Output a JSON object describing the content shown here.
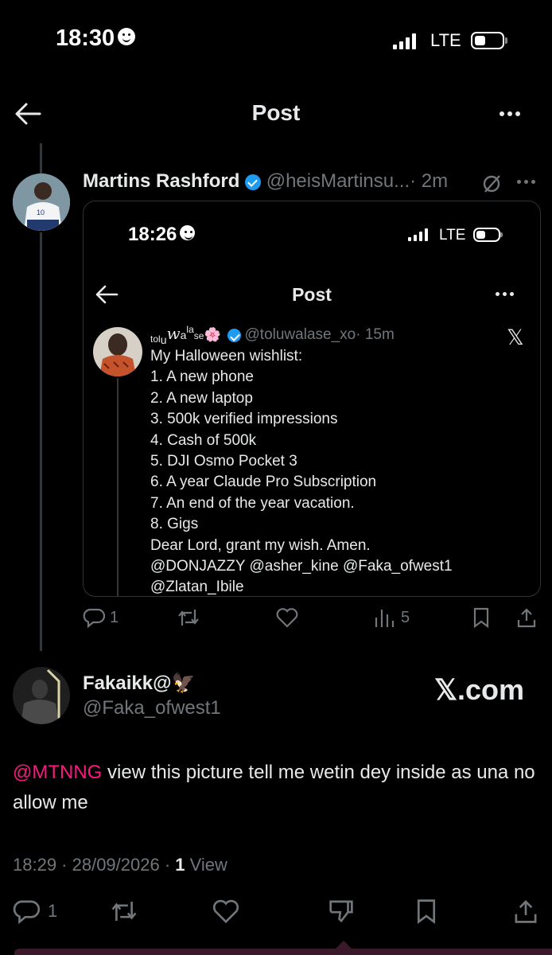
{
  "status_bar": {
    "time": "18:30",
    "network": "LTE"
  },
  "header": {
    "title": "Post"
  },
  "quoted_post": {
    "author_name": "Martins Rashford",
    "handle": "@heisMartinsu...",
    "time": "· 2m",
    "screenshot": {
      "status_time": "18:26",
      "network": "LTE",
      "header_title": "Post",
      "tweet": {
        "display_name_parts": [
          "tol",
          "u",
          "w",
          "a",
          "la",
          "se"
        ],
        "emoji": "🌸",
        "handle": "@toluwalase_xo",
        "time": "· 15m",
        "lines": [
          "My Halloween wishlist:",
          "1. A new phone",
          "2. A new laptop",
          "3. 500k verified impressions",
          "4. Cash of 500k",
          "5. DJI Osmo Pocket 3",
          "6. A year Claude Pro Subscription",
          "7. An end of the year vacation.",
          "8. Gigs",
          "Dear Lord, grant my wish. Amen."
        ],
        "mentions_line1": "@DONJAZZY @asher_kine @Faka_ofwest1",
        "mentions_line2": "@Zlatan_Ibile"
      }
    },
    "stats": {
      "replies": "1",
      "views": "5"
    }
  },
  "main_post": {
    "author_name": "Fakaikk@",
    "author_emoji": "🦅",
    "handle": "@Faka_ofwest1",
    "watermark": "𝕏.com",
    "mention": "@MTNNG",
    "text": " view this picture tell me wetin dey inside as una no allow me",
    "timestamp": "18:29 · 28/09/2026 · ",
    "view_count": "1",
    "view_label": " View",
    "replies": "1"
  },
  "colors": {
    "accent_blue": "#1d9bf0",
    "mention_pink": "#f91880",
    "muted": "#71767b",
    "background": "#000000"
  },
  "icons": [
    "back-arrow-icon",
    "more-icon",
    "verified-icon",
    "grok-icon",
    "x-logo-icon",
    "reply-icon",
    "retweet-icon",
    "like-icon",
    "views-icon",
    "bookmark-icon",
    "share-icon",
    "dislike-icon"
  ]
}
